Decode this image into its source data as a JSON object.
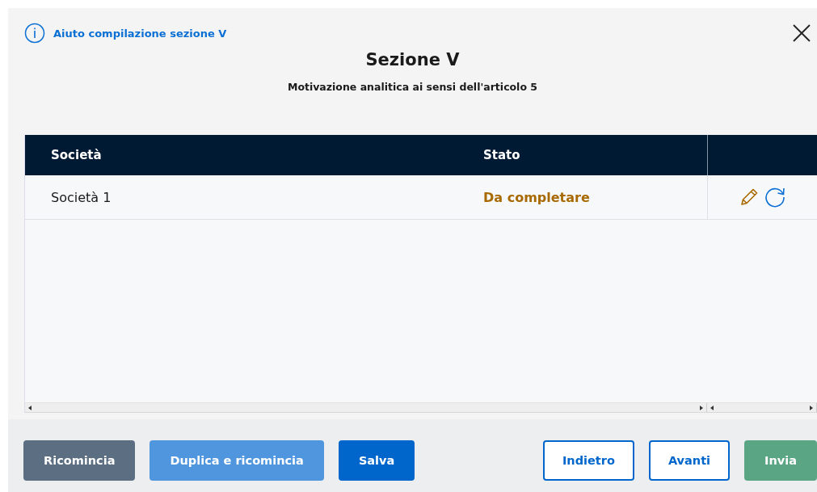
{
  "help_link": "Aiuto compilazione sezione V",
  "title": "Sezione V",
  "subtitle": "Motivazione analitica ai sensi dell'articolo 5",
  "table": {
    "columns": [
      "Società",
      "Stato"
    ],
    "rows": [
      {
        "name": "Società 1",
        "status": "Da completare",
        "color": "#a86a00"
      }
    ]
  },
  "buttons": [
    {
      "label": "Ricomincia",
      "kind": "neutral"
    },
    {
      "label": "Duplica e ricomincia",
      "kind": "light"
    },
    {
      "label": "Salva",
      "kind": "primary"
    },
    {
      "label": "Indietro",
      "kind": "outline"
    },
    {
      "label": "Avanti",
      "kind": "outline"
    },
    {
      "label": "Invia",
      "kind": "success"
    }
  ]
}
